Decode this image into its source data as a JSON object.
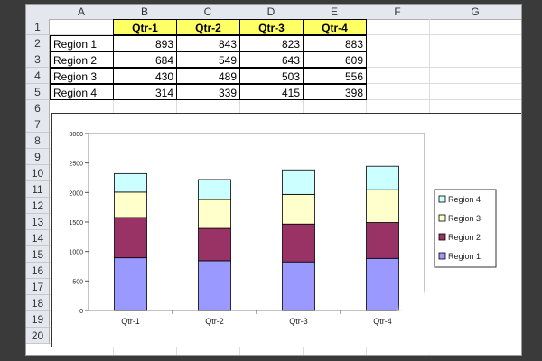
{
  "columns": [
    "A",
    "B",
    "C",
    "D",
    "E",
    "F",
    "G"
  ],
  "rows": [
    "1",
    "2",
    "3",
    "4",
    "5",
    "6",
    "7",
    "8",
    "9",
    "10",
    "11",
    "12",
    "13",
    "14",
    "15",
    "16",
    "17",
    "18",
    "19",
    "20"
  ],
  "table": {
    "headers": [
      "Qtr-1",
      "Qtr-2",
      "Qtr-3",
      "Qtr-4"
    ],
    "rows": [
      {
        "label": "Region 1",
        "values": [
          "893",
          "843",
          "823",
          "883"
        ]
      },
      {
        "label": "Region 2",
        "values": [
          "684",
          "549",
          "643",
          "609"
        ]
      },
      {
        "label": "Region 3",
        "values": [
          "430",
          "489",
          "503",
          "556"
        ]
      },
      {
        "label": "Region 4",
        "values": [
          "314",
          "339",
          "415",
          "398"
        ]
      }
    ]
  },
  "chart_data": {
    "type": "bar",
    "stacked": true,
    "categories": [
      "Qtr-1",
      "Qtr-2",
      "Qtr-3",
      "Qtr-4"
    ],
    "series": [
      {
        "name": "Region 1",
        "values": [
          893,
          843,
          823,
          883
        ],
        "color": "#9999ff"
      },
      {
        "name": "Region 2",
        "values": [
          684,
          549,
          643,
          609
        ],
        "color": "#993366"
      },
      {
        "name": "Region 3",
        "values": [
          430,
          489,
          503,
          556
        ],
        "color": "#ffffcc"
      },
      {
        "name": "Region 4",
        "values": [
          314,
          339,
          415,
          398
        ],
        "color": "#ccffff"
      }
    ],
    "ylim": [
      0,
      3000
    ],
    "yticks": [
      "0",
      "500",
      "1000",
      "1500",
      "2000",
      "2500",
      "3000"
    ],
    "legend": [
      "Region 4",
      "Region 3",
      "Region 2",
      "Region 1"
    ],
    "legend_position": "right",
    "grid": false
  },
  "colors": {
    "header_fill": "#ffff66",
    "header_bg": "#e4e8ee"
  }
}
